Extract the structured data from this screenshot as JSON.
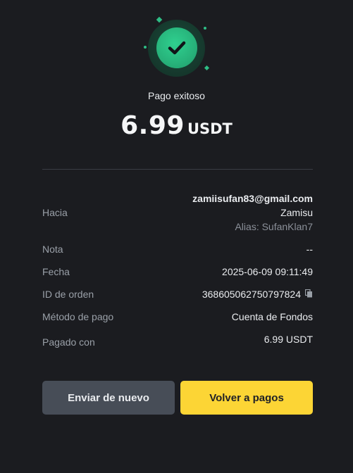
{
  "status": {
    "title": "Pago exitoso",
    "amount": "6.99",
    "currency": "USDT",
    "accent_color": "#2ebd85",
    "icon": "check-circle-icon"
  },
  "details": {
    "to": {
      "label": "Hacia",
      "email": "zamiisufan83@gmail.com",
      "name": "Zamisu",
      "alias": "Alias: SufanKlan7"
    },
    "note": {
      "label": "Nota",
      "value": "--"
    },
    "date": {
      "label": "Fecha",
      "value": "2025-06-09 09:11:49"
    },
    "order_id": {
      "label": "ID de orden",
      "value": "368605062750797824",
      "icon": "copy-icon"
    },
    "method": {
      "label": "Método de pago",
      "value": "Cuenta de Fondos"
    },
    "paid_with": {
      "label": "Pagado con",
      "value": "6.99 USDT"
    }
  },
  "actions": {
    "send_again": "Enviar de nuevo",
    "back_to_payments": "Volver a pagos",
    "primary_color": "#fcd535"
  }
}
